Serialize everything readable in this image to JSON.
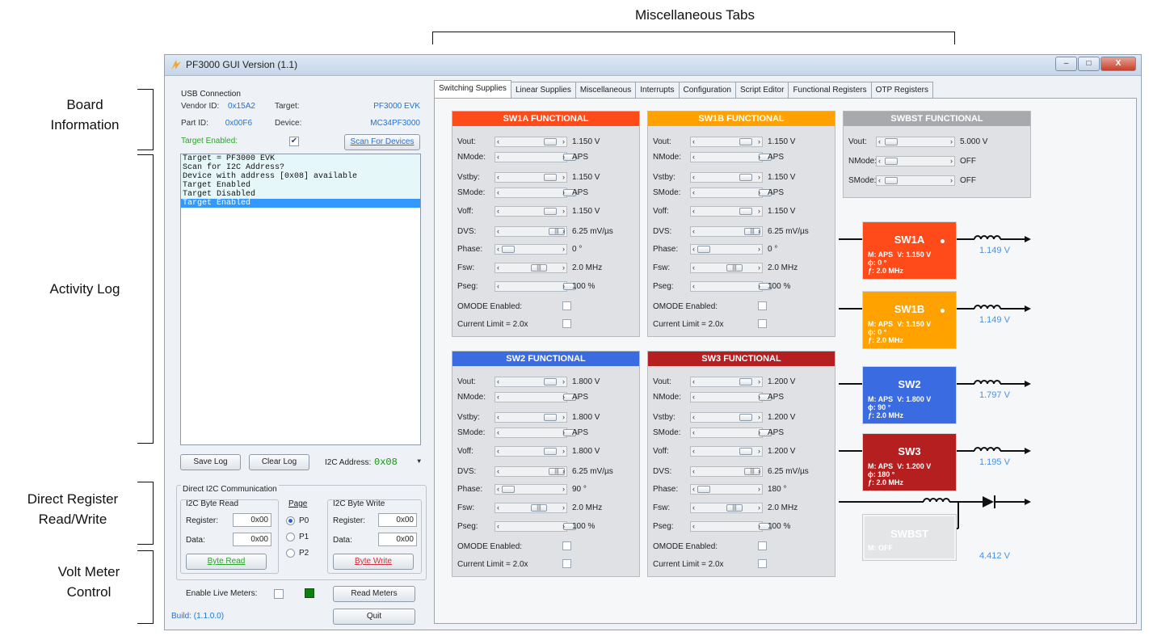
{
  "annotations": {
    "misc_tabs": "Miscellaneous Tabs",
    "board_info": [
      "Board",
      "Information"
    ],
    "activity_log": "Activity Log",
    "direct_register": [
      "Direct Register",
      "Read/Write"
    ],
    "volt_meter": [
      "Volt Meter",
      "Control"
    ]
  },
  "window": {
    "title": "PF3000 GUI Version (1.1)",
    "buttons": [
      "–",
      "□",
      "X"
    ]
  },
  "usb": {
    "group_label": "USB Connection",
    "vendor_label": "Vendor ID:",
    "vendor_value": "0x15A2",
    "target_label": "Target:",
    "target_value": "PF3000 EVK",
    "part_label": "Part ID:",
    "part_value": "0x00F6",
    "device_label": "Device:",
    "device_value": "MC34PF3000",
    "enabled_label": "Target Enabled:",
    "enabled_checked": true,
    "scan_button": "Scan For Devices"
  },
  "log": {
    "lines": [
      "Target = PF3000 EVK",
      "Scan for I2C Address?",
      "Device with address [0x08] available",
      "Target Enabled",
      "Target Disabled",
      "Target Enabled"
    ],
    "selected_index": 5,
    "save_button": "Save Log",
    "clear_button": "Clear Log",
    "i2c_label": "I2C Address:",
    "i2c_value": "0x08"
  },
  "direct": {
    "group_label": "Direct I2C Communication",
    "read_title": "I2C Byte Read",
    "read_register_label": "Register:",
    "read_register_value": "0x00",
    "read_data_label": "Data:",
    "read_data_value": "0x00",
    "read_button": "Byte Read",
    "page_title": "Page",
    "pages": [
      "P0",
      "P1",
      "P2"
    ],
    "page_selected": 0,
    "write_title": "I2C Byte Write",
    "write_register_label": "Register:",
    "write_register_value": "0x00",
    "write_data_label": "Data:",
    "write_data_value": "0x00",
    "write_button": "Byte Write"
  },
  "meters": {
    "enable_label": "Enable Live Meters:",
    "read_button": "Read Meters",
    "build": "Build: (1.1.0.0)",
    "quit_button": "Quit"
  },
  "tabs": [
    "Switching Supplies",
    "Linear Supplies",
    "Miscellaneous",
    "Interrupts",
    "Configuration",
    "Script Editor",
    "Functional Registers",
    "OTP Registers"
  ],
  "active_tab": 0,
  "panels": {
    "sw1a": {
      "title": "SW1A FUNCTIONAL",
      "color": "#ff4a1a",
      "rows": [
        {
          "label": "Vout:",
          "value": "1.150 V"
        },
        {
          "label": "NMode:",
          "value": "APS"
        },
        {
          "label": "Vstby:",
          "value": "1.150 V"
        },
        {
          "label": "SMode:",
          "value": "APS"
        },
        {
          "label": "Voff:",
          "value": "1.150 V"
        },
        {
          "label": "DVS:",
          "value": "6.25 mV/µs"
        },
        {
          "label": "Phase:",
          "value": "0 °"
        },
        {
          "label": "Fsw:",
          "value": "2.0 MHz"
        },
        {
          "label": "Pseg:",
          "value": "100 %"
        }
      ],
      "omode_label": "OMODE Enabled:",
      "ilim_label": "Current Limit = 2.0x"
    },
    "sw1b": {
      "title": "SW1B FUNCTIONAL",
      "color": "#ffa200",
      "rows": [
        {
          "label": "Vout:",
          "value": "1.150 V"
        },
        {
          "label": "NMode:",
          "value": "APS"
        },
        {
          "label": "Vstby:",
          "value": "1.150 V"
        },
        {
          "label": "SMode:",
          "value": "APS"
        },
        {
          "label": "Voff:",
          "value": "1.150 V"
        },
        {
          "label": "DVS:",
          "value": "6.25 mV/µs"
        },
        {
          "label": "Phase:",
          "value": "0 °"
        },
        {
          "label": "Fsw:",
          "value": "2.0 MHz"
        },
        {
          "label": "Pseg:",
          "value": "100 %"
        }
      ],
      "omode_label": "OMODE Enabled:",
      "ilim_label": "Current Limit = 2.0x"
    },
    "sw2": {
      "title": "SW2 FUNCTIONAL",
      "color": "#3b6be0",
      "rows": [
        {
          "label": "Vout:",
          "value": "1.800 V"
        },
        {
          "label": "NMode:",
          "value": "APS"
        },
        {
          "label": "Vstby:",
          "value": "1.800 V"
        },
        {
          "label": "SMode:",
          "value": "APS"
        },
        {
          "label": "Voff:",
          "value": "1.800 V"
        },
        {
          "label": "DVS:",
          "value": "6.25 mV/µs"
        },
        {
          "label": "Phase:",
          "value": "90 °"
        },
        {
          "label": "Fsw:",
          "value": "2.0 MHz"
        },
        {
          "label": "Pseg:",
          "value": "100 %"
        }
      ],
      "omode_label": "OMODE Enabled:",
      "ilim_label": "Current Limit = 2.0x"
    },
    "sw3": {
      "title": "SW3 FUNCTIONAL",
      "color": "#b51f1f",
      "rows": [
        {
          "label": "Vout:",
          "value": "1.200 V"
        },
        {
          "label": "NMode:",
          "value": "APS"
        },
        {
          "label": "Vstby:",
          "value": "1.200 V"
        },
        {
          "label": "SMode:",
          "value": "APS"
        },
        {
          "label": "Voff:",
          "value": "1.200 V"
        },
        {
          "label": "DVS:",
          "value": "6.25 mV/µs"
        },
        {
          "label": "Phase:",
          "value": "180 °"
        },
        {
          "label": "Fsw:",
          "value": "2.0 MHz"
        },
        {
          "label": "Pseg:",
          "value": "100 %"
        }
      ],
      "omode_label": "OMODE Enabled:",
      "ilim_label": "Current Limit = 2.0x"
    },
    "swbst": {
      "title": "SWBST FUNCTIONAL",
      "color": "#a7a9ac",
      "rows": [
        {
          "label": "Vout:",
          "value": "5.000 V"
        },
        {
          "label": "NMode:",
          "value": "OFF"
        },
        {
          "label": "SMode:",
          "value": "OFF"
        }
      ]
    }
  },
  "regulators": [
    {
      "key": "sw1a",
      "name": "SW1A",
      "color": "#ff4a1a",
      "mode": "M: APS",
      "volt": "V: 1.150 V",
      "phase": "ϕ: 0 °",
      "freq": "ƒ: 2.0 MHz",
      "measured": "1.149 V",
      "dot": true
    },
    {
      "key": "sw1b",
      "name": "SW1B",
      "color": "#ffa200",
      "mode": "M: APS",
      "volt": "V: 1.150 V",
      "phase": "ϕ: 0 °",
      "freq": "ƒ: 2.0 MHz",
      "measured": "1.149 V",
      "dot": true
    },
    {
      "key": "sw2",
      "name": "SW2",
      "color": "#3b6be0",
      "mode": "M: APS",
      "volt": "V: 1.800 V",
      "phase": "ϕ: 90 °",
      "freq": "ƒ: 2.0 MHz",
      "measured": "1.797 V",
      "dot": false
    },
    {
      "key": "sw3",
      "name": "SW3",
      "color": "#b51f1f",
      "mode": "M: APS",
      "volt": "V: 1.200 V",
      "phase": "ϕ: 180 °",
      "freq": "ƒ: 2.0 MHz",
      "measured": "1.195 V",
      "dot": false
    }
  ],
  "swbst_box": {
    "name": "SWBST",
    "mode": "M: OFF",
    "measured": "4.412 V",
    "color": "#e4e5e7"
  },
  "colors": {
    "accent_blue": "#1e73d8",
    "meter_blue": "#4a90e2",
    "live_indicator": "#0f7d0f",
    "log_selected": "#3399ff"
  }
}
